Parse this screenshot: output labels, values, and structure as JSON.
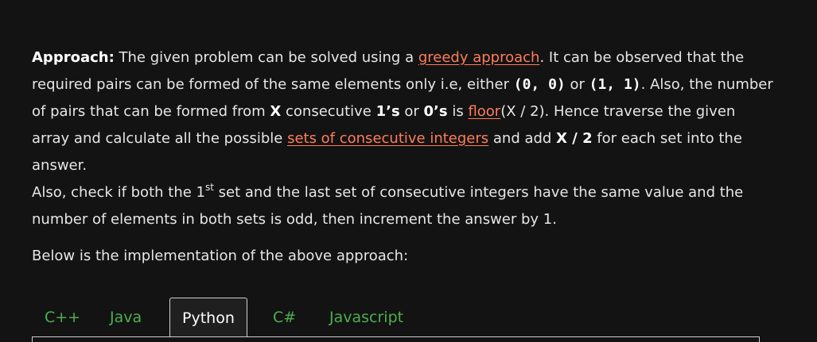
{
  "approach": {
    "label": "Approach:",
    "t1": " The given problem can be solved using a ",
    "link_greedy": "greedy approach",
    "t2": ". It can be observed that the",
    "t3": "required pairs can be formed of the same elements only i.e, either ",
    "pair1": "(0, 0)",
    "t4": " or ",
    "pair2": "(1, 1)",
    "t5": ". Also, the number",
    "t6": "of pairs that can be formed from ",
    "x1": "X",
    "t7": " consecutive ",
    "ones": "1’s",
    "t8": " or ",
    "zeros": "0’s",
    "t9": " is ",
    "link_floor": "floor",
    "t10": "(X / 2). Hence traverse the given",
    "t11": "array and calculate all the possible ",
    "link_sets": "sets of consecutive integers",
    "t12": " and add ",
    "x2": "X / 2",
    "t13": " for each set into the",
    "t14": "answer."
  },
  "also": {
    "t1": "Also, check if both the 1",
    "sup": "st",
    "t2": " set and the last set of consecutive integers have the same value and the",
    "t3": "number of elements in both sets is odd, then increment the answer by 1."
  },
  "below": "Below is the implementation of the above approach:",
  "tabs": [
    {
      "label": "C++"
    },
    {
      "label": "Java"
    },
    {
      "label": "Python"
    },
    {
      "label": "C#"
    },
    {
      "label": "Javascript"
    }
  ],
  "active_tab": "Python",
  "colors": {
    "background": "#131313",
    "link": "#ff7d5a",
    "tab": "#4caf50"
  }
}
